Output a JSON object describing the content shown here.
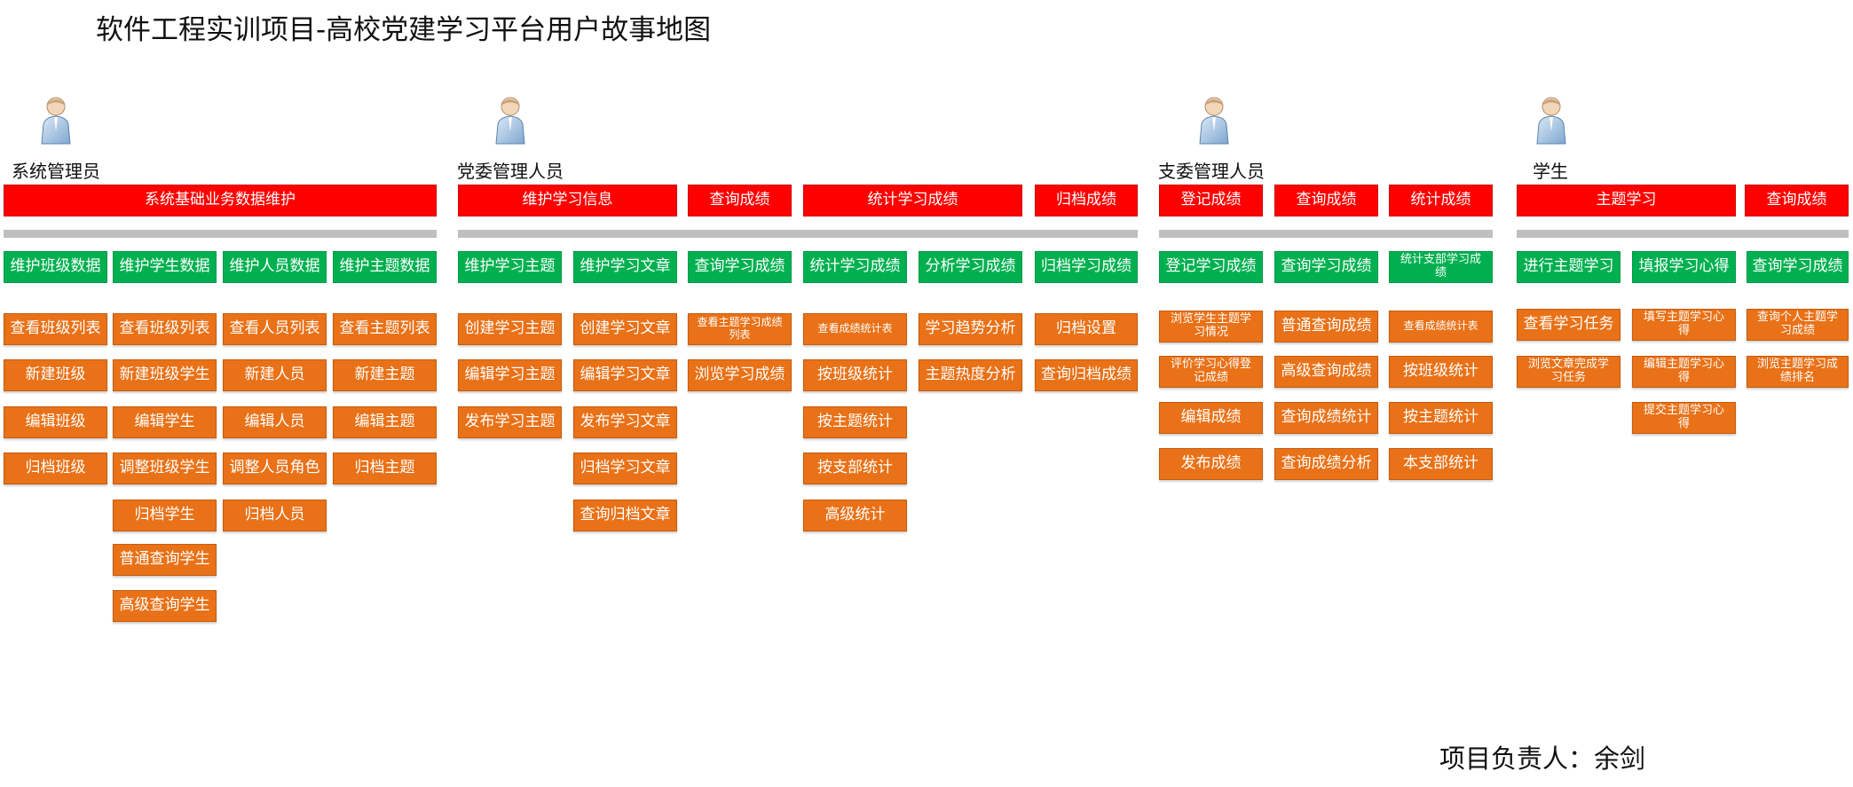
{
  "title": "软件工程实训项目-高校党建学习平台用户故事地图",
  "roles": [
    "系统管理员",
    "党委管理人员",
    "支委管理人员",
    "学生"
  ],
  "activities": [
    "系统基础业务数据维护",
    "维护学习信息",
    "查询成绩",
    "统计学习成绩",
    "归档成绩",
    "登记成绩",
    "查询成绩",
    "统计成绩",
    "主题学习",
    "查询成绩"
  ],
  "tasks": [
    "维护班级数据",
    "维护学生数据",
    "维护人员数据",
    "维护主题数据",
    "维护学习主题",
    "维护学习文章",
    "查询学习成绩",
    "统计学习成绩",
    "分析学习成绩",
    "归档学习成绩",
    "登记学习成绩",
    "查询学习成绩",
    "统计支部学习成绩",
    "进行主题学习",
    "填报学习心得",
    "查询学习成绩"
  ],
  "stories": [
    [
      "查看班级列表",
      "新建班级",
      "编辑班级",
      "归档班级"
    ],
    [
      "查看班级列表",
      "新建班级学生",
      "编辑学生",
      "调整班级学生",
      "归档学生",
      "普通查询学生",
      "高级查询学生"
    ],
    [
      "查看人员列表",
      "新建人员",
      "编辑人员",
      "调整人员角色",
      "归档人员"
    ],
    [
      "查看主题列表",
      "新建主题",
      "编辑主题",
      "归档主题"
    ],
    [
      "创建学习主题",
      "编辑学习主题",
      "发布学习主题"
    ],
    [
      "创建学习文章",
      "编辑学习文章",
      "发布学习文章",
      "归档学习文章",
      "查询归档文章"
    ],
    [
      "查看主题学习成绩列表",
      "浏览学习成绩"
    ],
    [
      "查看成绩统计表",
      "按班级统计",
      "按主题统计",
      "按支部统计",
      "高级统计"
    ],
    [
      "学习趋势分析",
      "主题热度分析"
    ],
    [
      "归档设置",
      "查询归档成绩"
    ],
    [
      "浏览学生主题学习情况",
      "评价学习心得登记成绩",
      "编辑成绩",
      "发布成绩"
    ],
    [
      "普通查询成绩",
      "高级查询成绩",
      "查询成绩统计",
      "查询成绩分析"
    ],
    [
      "查看成绩统计表",
      "按班级统计",
      "按主题统计",
      "本支部统计"
    ],
    [
      "查看学习任务",
      "浏览文章完成学习任务"
    ],
    [
      "填写主题学习心得",
      "编辑主题学习心得",
      "提交主题学习心得"
    ],
    [
      "查询个人主题学习成绩",
      "浏览主题学习成绩排名"
    ]
  ],
  "owner": "项目负责人：余剑",
  "icons": [
    "person-icon",
    "person-icon",
    "person-icon",
    "person-icon"
  ],
  "colors": {
    "activity": "#ff0000",
    "task": "#00b050",
    "story": "#e97117",
    "backbone": "#bfbfbf"
  }
}
